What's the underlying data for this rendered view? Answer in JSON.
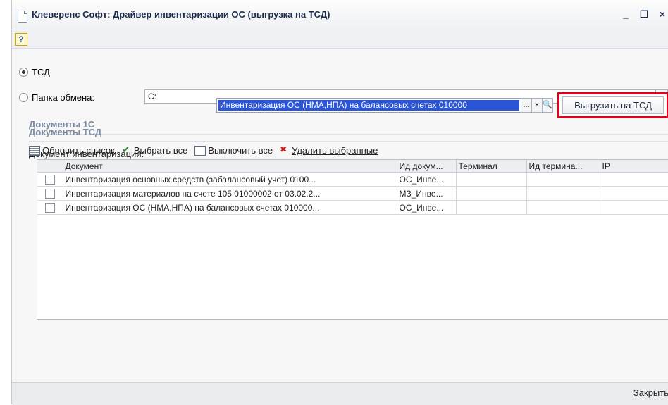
{
  "window": {
    "title": "Клеверенс Софт: Драйвер инвентаризации ОС (выгрузка на ТСД)",
    "minimize": "_",
    "maximize": "☐",
    "close": "×"
  },
  "toolbar": {
    "help": "?"
  },
  "mode": {
    "tsd_label": "ТСД",
    "folder_label": "Папка обмена:",
    "folder_value": "C:",
    "browse": "..."
  },
  "docs1c": {
    "section_title": "Документы 1С",
    "inventory_label": "Документ инвентаризации:",
    "inventory_value": "Инвентаризация ОС (НМА,НПА) на балансовых счетах 010000",
    "choose": "...",
    "clear": "×",
    "open": "🔍",
    "upload_button": "Выгрузить на ТСД"
  },
  "docsTsd": {
    "section_title": "Документы ТСД",
    "refresh": "Обновить список",
    "select_all": "Выбрать все",
    "deselect_all": "Выключить все",
    "delete_selected": "Удалить выбранные",
    "columns": [
      "Документ",
      "Ид докум...",
      "Терминал",
      "Ид термина...",
      "IP"
    ],
    "rows": [
      [
        "Инвентаризация основных средств (забалансовый учет) 0100...",
        "ОС_Инве...",
        "",
        "",
        ""
      ],
      [
        "Инвентаризация материалов на счете 105 01000002 от 03.02.2...",
        "МЗ_Инве...",
        "",
        "",
        ""
      ],
      [
        "Инвентаризация ОС (НМА,НПА) на балансовых счетах 010000...",
        "ОС_Инве...",
        "",
        "",
        ""
      ]
    ]
  },
  "footer": {
    "close_button": "Закрыть"
  }
}
